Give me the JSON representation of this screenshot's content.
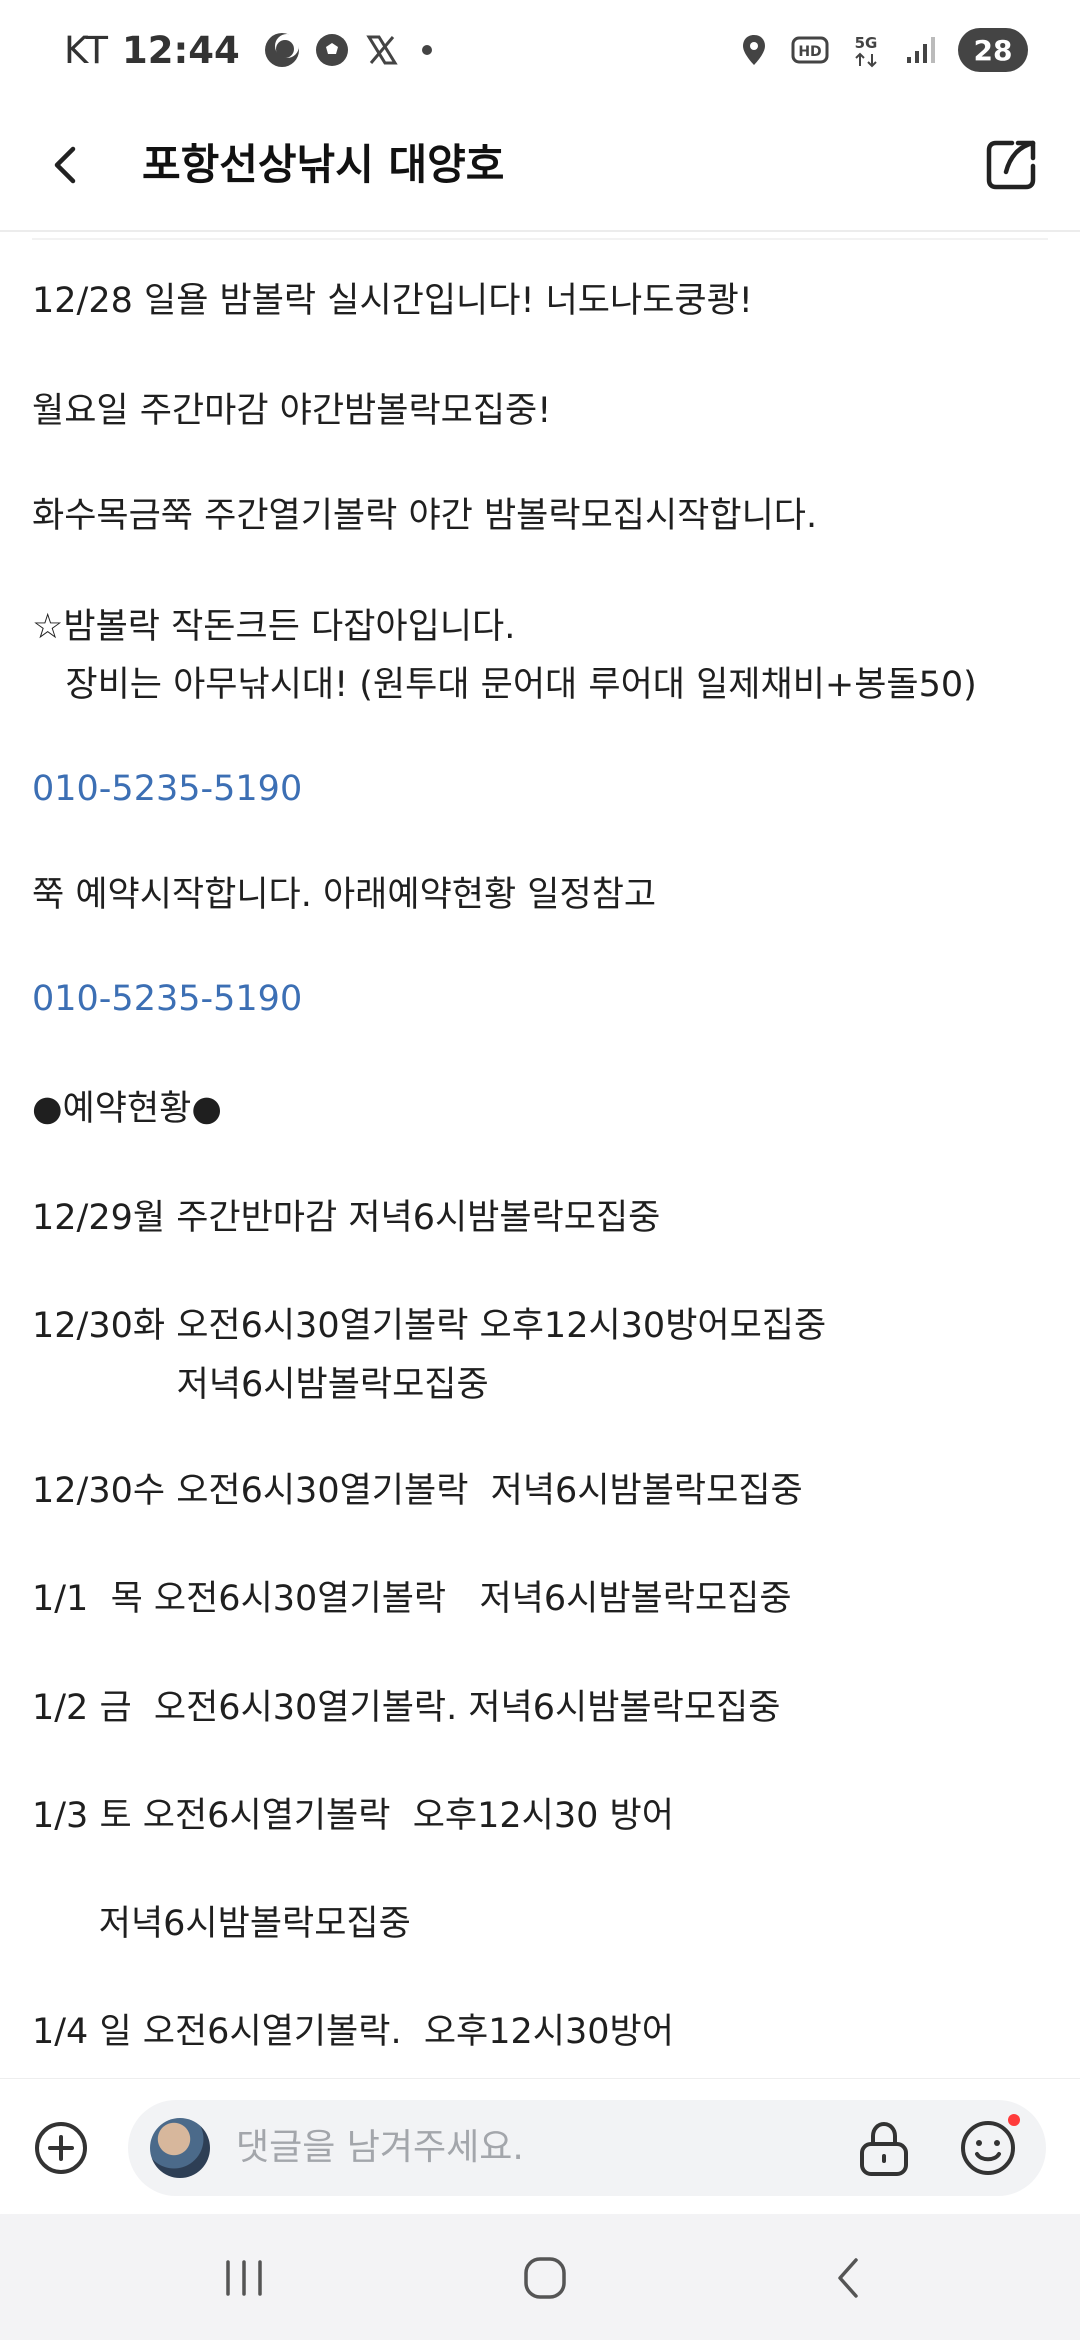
{
  "status_bar": {
    "carrier": "KT",
    "time": "12:44",
    "battery": "28",
    "icons": [
      "moon-icon",
      "soccer-ball-icon",
      "x-logo-icon",
      "location-icon",
      "hd-icon",
      "5g-icon",
      "signal-icon",
      "battery-icon"
    ]
  },
  "header": {
    "title": "포항선상낚시 대양호",
    "back_icon": "back-arrow-icon",
    "share_icon": "share-icon"
  },
  "post": {
    "lines": [
      "12/28 일욜 밤볼락 실시간입니다! 너도나도쿵쾅!",
      "월요일 주간마감 야간밤볼락모집중!",
      "화수목금쭉 주간열기볼락 야간 밤볼락모집시작합니다.",
      "☆밤볼락 작돈크든 다잡아입니다.",
      "   장비는 아무낚시대! (원투대 문어대 루어대 일제채비+봉돌50)",
      "010-5235-5190",
      "쭉 예약시작합니다. 아래예약현황 일정참고",
      "010-5235-5190",
      "●예약현황●",
      "12/29월 주간반마감 저녁6시밤볼락모집중",
      "12/30화 오전6시30열기볼락 오후12시30방어모집중",
      "             저녁6시밤볼락모집중",
      "12/30수 오전6시30열기볼락  저녁6시밤볼락모집중",
      "1/1  목 오전6시30열기볼락   저녁6시밤볼락모집중",
      "1/2 금  오전6시30열기볼락. 저녁6시밤볼락모집중",
      "1/3 토 오전6시열기볼락  오후12시30 방어",
      "      저녁6시밤볼락모집중",
      "1/4 일 오전6시열기볼락.  오후12시30방어"
    ]
  },
  "comment_bar": {
    "placeholder": "댓글을 남겨주세요."
  },
  "colors": {
    "link": "#3c6fb4",
    "text": "#1f1f1f",
    "placeholder": "#a3a6ab",
    "notification_dot": "#ff3b3b"
  }
}
